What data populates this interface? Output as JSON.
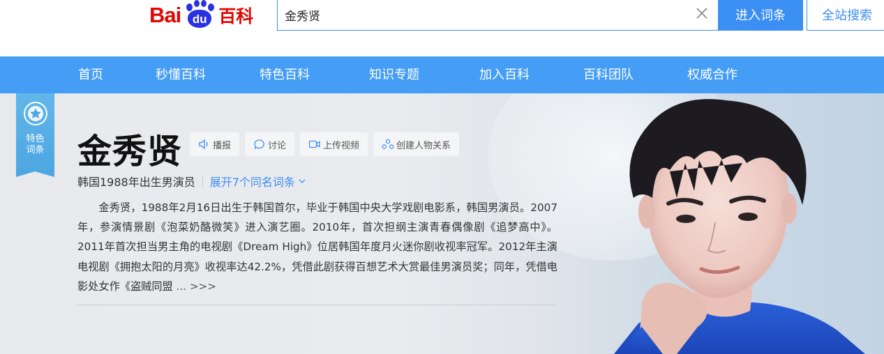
{
  "header": {
    "logo_text_1": "Bai",
    "logo_paw_text": "du",
    "logo_text_2": "百科",
    "search_value": "金秀贤",
    "enter_button": "进入词条",
    "all_button": "全站搜索"
  },
  "nav": {
    "items": [
      {
        "label": "首页"
      },
      {
        "label": "秒懂百科"
      },
      {
        "label": "特色百科"
      },
      {
        "label": "知识专题"
      },
      {
        "label": "加入百科"
      },
      {
        "label": "百科团队"
      },
      {
        "label": "权威合作"
      }
    ]
  },
  "badge": {
    "line1": "特色",
    "line2": "词条"
  },
  "entry": {
    "title": "金秀贤",
    "actions": [
      {
        "label": "播报",
        "icon": "speaker-icon"
      },
      {
        "label": "讨论",
        "icon": "chat-bubble-icon"
      },
      {
        "label": "上传视频",
        "icon": "video-camera-icon"
      },
      {
        "label": "创建人物关系",
        "icon": "people-relation-icon"
      }
    ],
    "subtitle": "韩国1988年出生男演员",
    "expand_link": "展开7个同名词条",
    "summary": "金秀贤，1988年2月16日出生于韩国首尔，毕业于韩国中央大学戏剧电影系，韩国男演员。2007年，参演情景剧《泡菜奶酪微笑》进入演艺圈。2010年，首次担纲主演青春偶像剧《追梦高中》。2011年首次担当男主角的电视剧《Dream High》位居韩国年度月火迷你剧收视率冠军。2012年主演电视剧《拥抱太阳的月亮》收视率达42.2%，凭借此剧获得百想艺术大赏最佳男演员奖；同年，凭借电影处女作《盗贼同盟",
    "summary_more": " ... >>>"
  },
  "colors": {
    "brand_red": "#e10601",
    "brand_blue": "#2932e1",
    "accent_blue": "#3b8ff3",
    "nav_blue": "#459df5"
  }
}
